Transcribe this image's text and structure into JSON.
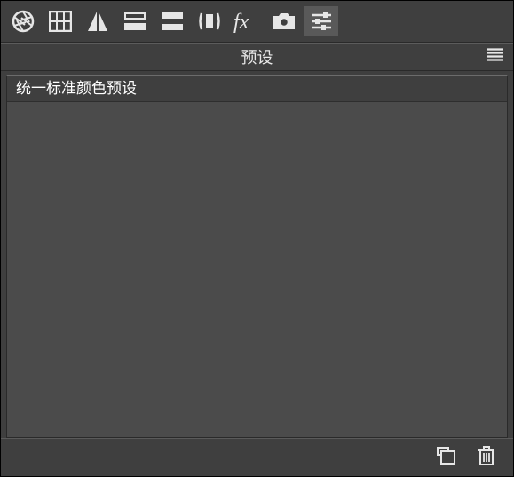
{
  "tabs": {
    "aperture": {
      "name": "aperture-icon"
    },
    "grid": {
      "name": "histogram-icon"
    },
    "mirror": {
      "name": "sharpen-icon"
    },
    "levels": {
      "name": "levels-icon"
    },
    "rows": {
      "name": "split-rows-icon"
    },
    "compare": {
      "name": "lens-correction-icon"
    },
    "fx": {
      "name": "effects-icon"
    },
    "camera": {
      "name": "camera-icon"
    },
    "sliders": {
      "name": "presets-icon",
      "selected": true
    }
  },
  "panel": {
    "title": "预设"
  },
  "presets": {
    "items": [
      {
        "label": "统一标准颜色预设"
      }
    ]
  },
  "footer": {
    "new": {
      "name": "new-preset-button"
    },
    "delete": {
      "name": "delete-preset-button"
    }
  }
}
